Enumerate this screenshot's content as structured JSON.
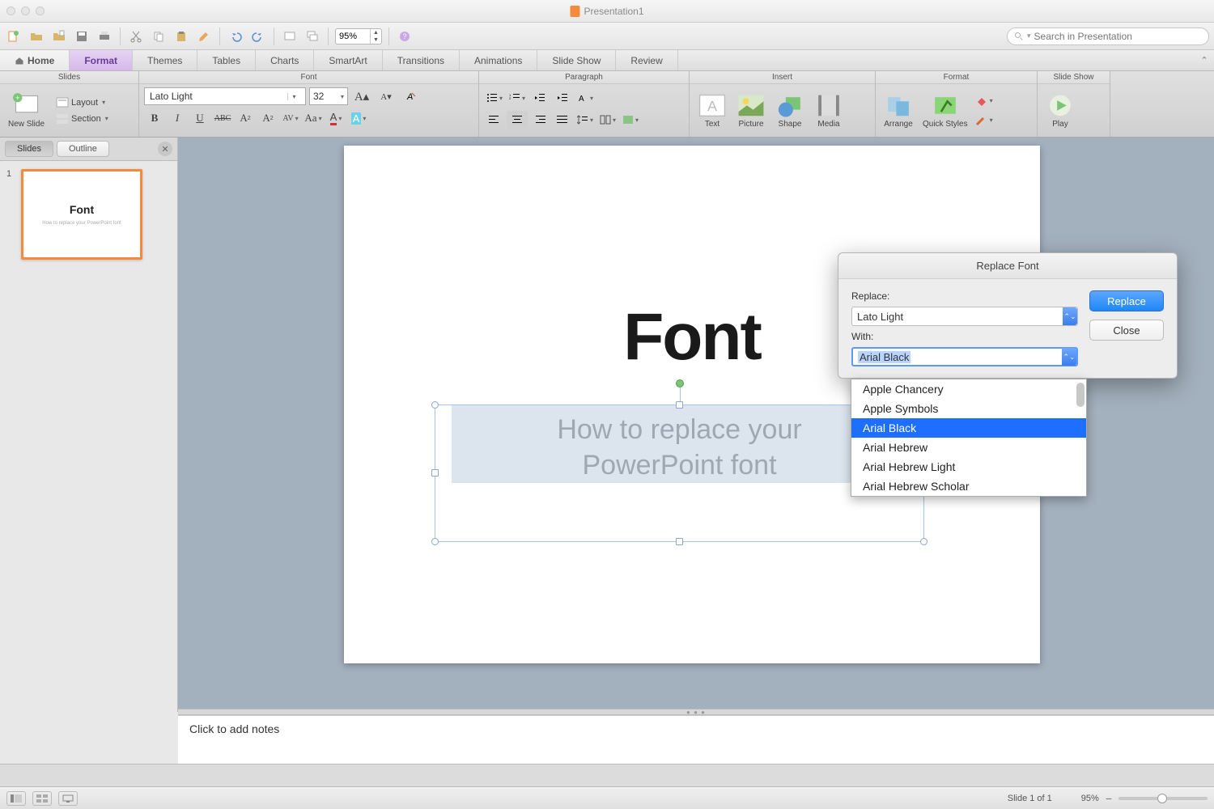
{
  "window": {
    "title": "Presentation1"
  },
  "toolbar": {
    "zoom": "95%",
    "search_placeholder": "Search in Presentation"
  },
  "tabs": {
    "home": "Home",
    "format": "Format",
    "themes": "Themes",
    "tables": "Tables",
    "charts": "Charts",
    "smartart": "SmartArt",
    "transitions": "Transitions",
    "animations": "Animations",
    "slideshow": "Slide Show",
    "review": "Review"
  },
  "ribbon": {
    "groups": {
      "slides": "Slides",
      "font": "Font",
      "paragraph": "Paragraph",
      "insert": "Insert",
      "format": "Format",
      "slideshow": "Slide Show"
    },
    "slides": {
      "new": "New Slide",
      "layout": "Layout",
      "section": "Section"
    },
    "font": {
      "name": "Lato Light",
      "size": "32"
    },
    "insert": {
      "text": "Text",
      "picture": "Picture",
      "shape": "Shape",
      "media": "Media"
    },
    "format": {
      "arrange": "Arrange",
      "quick": "Quick Styles"
    },
    "slideshow": {
      "play": "Play"
    }
  },
  "sidepanel": {
    "slides_tab": "Slides",
    "outline_tab": "Outline",
    "thumb_num": "1",
    "thumb_title": "Font",
    "thumb_sub": "How to replace your PowerPoint font"
  },
  "slide": {
    "title": "Font",
    "subtitle_l1": "How to replace your",
    "subtitle_l2": "PowerPoint font"
  },
  "dialog": {
    "title": "Replace Font",
    "replace_label": "Replace:",
    "replace_value": "Lato Light",
    "with_label": "With:",
    "with_value": "Arial Black",
    "replace_btn": "Replace",
    "close_btn": "Close",
    "options": [
      "Apple Chancery",
      "Apple Symbols",
      "Arial Black",
      "Arial Hebrew",
      "Arial Hebrew Light",
      "Arial Hebrew Scholar"
    ]
  },
  "notes": {
    "placeholder": "Click to add notes"
  },
  "status": {
    "slide": "Slide 1 of 1",
    "zoom": "95%"
  }
}
